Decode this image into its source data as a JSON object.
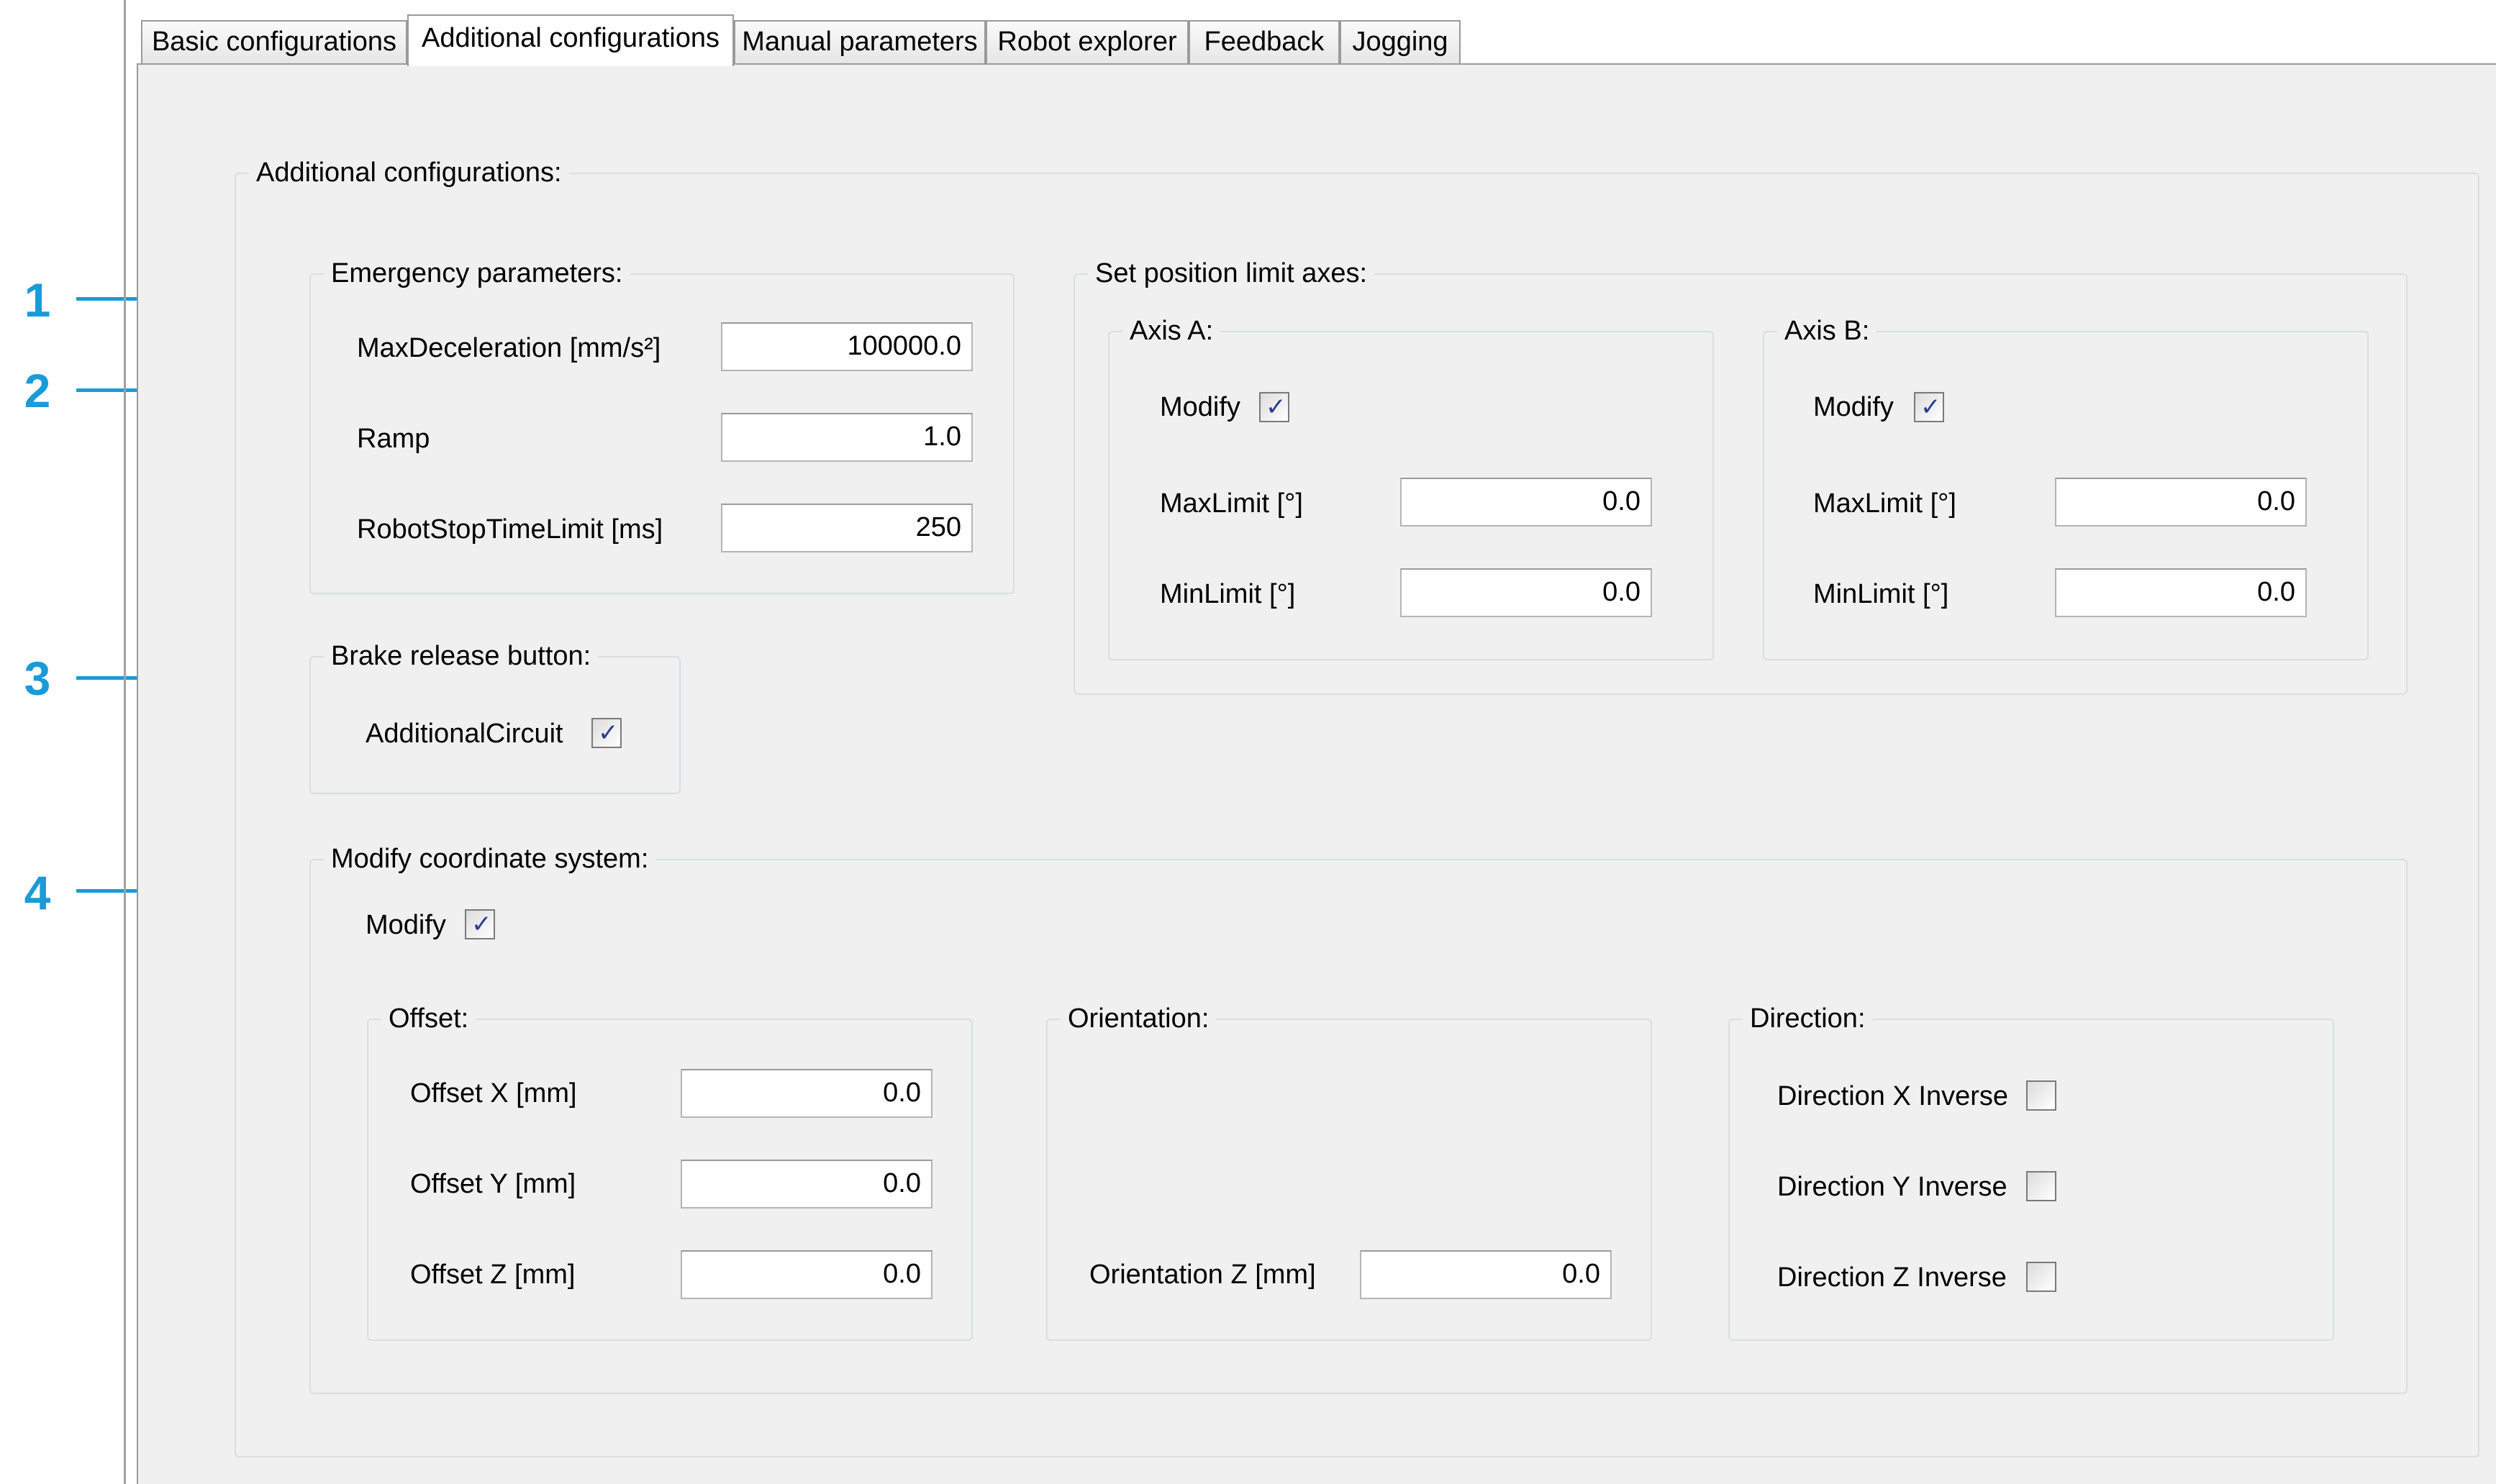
{
  "callouts": [
    "1",
    "2",
    "3",
    "4"
  ],
  "tabs": [
    {
      "label": "Basic configurations"
    },
    {
      "label": "Additional configurations"
    },
    {
      "label": "Manual parameters"
    },
    {
      "label": "Robot explorer"
    },
    {
      "label": "Feedback"
    },
    {
      "label": "Jogging"
    }
  ],
  "main": {
    "title": "Additional configurations:"
  },
  "emergency": {
    "title": "Emergency parameters:",
    "max_decel_label": "MaxDeceleration [mm/s²]",
    "max_decel_value": "100000.0",
    "ramp_label": "Ramp",
    "ramp_value": "1.0",
    "stop_time_label": "RobotStopTimeLimit [ms]",
    "stop_time_value": "250"
  },
  "position_limit": {
    "title": "Set position limit axes:",
    "axis_a": {
      "title": "Axis A:",
      "modify_label": "Modify",
      "modify_checked": true,
      "max_label": "MaxLimit [°]",
      "max_value": "0.0",
      "min_label": "MinLimit [°]",
      "min_value": "0.0"
    },
    "axis_b": {
      "title": "Axis B:",
      "modify_label": "Modify",
      "modify_checked": true,
      "max_label": "MaxLimit [°]",
      "max_value": "0.0",
      "min_label": "MinLimit [°]",
      "min_value": "0.0"
    }
  },
  "brake": {
    "title": "Brake release button:",
    "circuit_label": "AdditionalCircuit",
    "circuit_checked": true
  },
  "coord": {
    "title": "Modify coordinate system:",
    "modify_label": "Modify",
    "modify_checked": true,
    "offset": {
      "title": "Offset:",
      "x_label": "Offset X [mm]",
      "x_value": "0.0",
      "y_label": "Offset Y [mm]",
      "y_value": "0.0",
      "z_label": "Offset Z [mm]",
      "z_value": "0.0"
    },
    "orientation": {
      "title": "Orientation:",
      "z_label": "Orientation Z [mm]",
      "z_value": "0.0"
    },
    "direction": {
      "title": "Direction:",
      "x_label": "Direction X Inverse",
      "x_checked": false,
      "y_label": "Direction Y Inverse",
      "y_checked": false,
      "z_label": "Direction Z Inverse",
      "z_checked": false
    }
  },
  "check_glyph": "✓",
  "accent_color": "#1a9bd7"
}
